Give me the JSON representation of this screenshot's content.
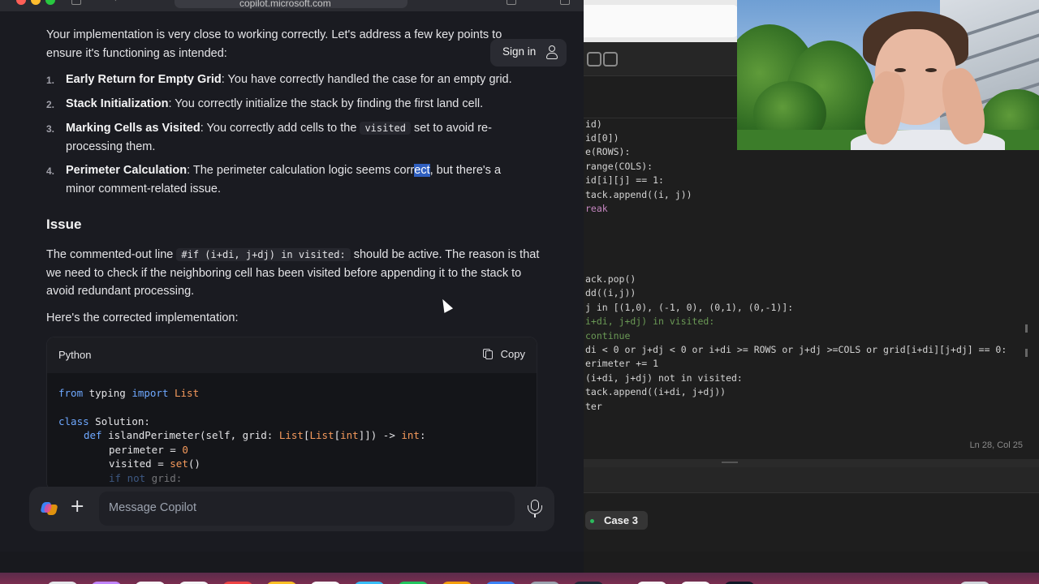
{
  "browser": {
    "url": "copilot.microsoft.com"
  },
  "header": {
    "sign_in_label": "Sign in"
  },
  "chat": {
    "intro": "Your implementation is very close to working correctly. Let's address a few key points to ensure it's functioning as intended:",
    "points": [
      {
        "num": "1.",
        "title": "Early Return for Empty Grid",
        "text": ": You have correctly handled the case for an empty grid."
      },
      {
        "num": "2.",
        "title": "Stack Initialization",
        "text": ": You correctly initialize the stack by finding the first land cell."
      },
      {
        "num": "3.",
        "title": "Marking Cells as Visited",
        "text_before": ": You correctly add cells to the",
        "code": "visited",
        "text_after": "set to avoid re-processing them."
      },
      {
        "num": "4.",
        "title": "Perimeter Calculation",
        "text_before": ": The perimeter calculation logic seems corr",
        "highlight": "ect",
        "text_after": ", but there's a minor comment-related issue."
      }
    ],
    "issue_heading": "Issue",
    "issue_before": "The commented-out line",
    "issue_code": "#if (i+di, j+dj) in visited:",
    "issue_after": "should be active. The reason is that we need to check if the neighboring cell has been visited before appending it to the stack to avoid redundant processing.",
    "corrected_intro": "Here's the corrected implementation:",
    "code_block": {
      "language": "Python",
      "copy_label": "Copy",
      "lines": {
        "l1_kw1": "from",
        "l1_mod": " typing ",
        "l1_kw2": "import",
        "l1_ty": " List",
        "l2_kw": "class",
        "l2_name": " Solution:",
        "l3_kw": "def",
        "l3_name": " islandPerimeter(self, grid: ",
        "l3_t1": "List",
        "l3_b1": "[",
        "l3_t2": "List",
        "l3_b2": "[",
        "l3_t3": "int",
        "l3_b3": "]]) -> ",
        "l3_t4": "int",
        "l3_end": ":",
        "l4": "perimeter = ",
        "l4_num": "0",
        "l5": "visited = ",
        "l5_fn": "set",
        "l5_end": "()",
        "l6_kw": "if not",
        "l6_rest": " grid:"
      }
    }
  },
  "composer": {
    "add_label": "+",
    "placeholder": "Message Copilot"
  },
  "editor": {
    "code_lines": [
      "id)",
      "id[0])",
      "e(ROWS):",
      "range(COLS):",
      "id[i][j] == 1:",
      "tack.append((i, j))",
      "reak",
      "ack.pop()",
      "dd((i,j))",
      "j in [(1,0), (-1, 0), (0,1), (0,-1)]:",
      "i+di, j+dj) in visited:",
      "continue",
      "di < 0 or j+dj < 0 or i+di >= ROWS or j+dj >=COLS or grid[i+di][j+dj] == 0:",
      "erimeter += 1",
      "(i+di, j+dj) not in visited:",
      "tack.append((i+di, j+dj))",
      "ter"
    ],
    "cursor_position": "Ln 28, Col 25",
    "test_case_label": "Case 3"
  },
  "colors": {
    "browser_bg": "#1a1b21",
    "accent_keyword": "#6ea8ff",
    "accent_type": "#f59a5c",
    "selection": "#2f5fbf"
  }
}
